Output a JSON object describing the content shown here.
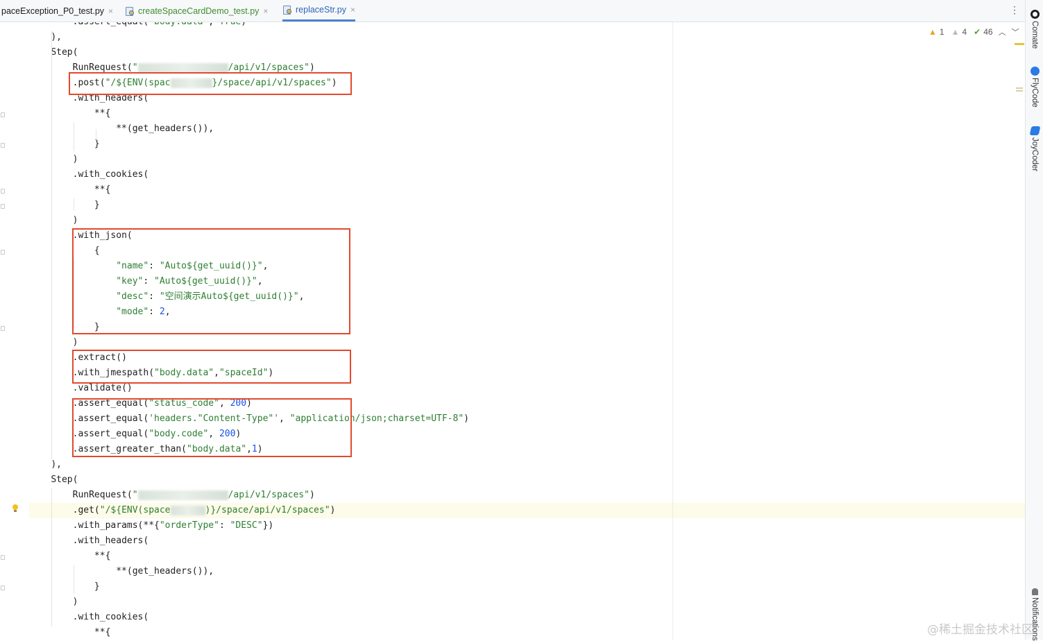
{
  "tabs": [
    {
      "label": "paceException_P0_test.py"
    },
    {
      "label": "createSpaceCardDemo_test.py"
    },
    {
      "label": "replaceStr.py"
    }
  ],
  "tab_close_glyph": "×",
  "tab_menu_glyph": "⋮",
  "inspections": {
    "warnings": "1",
    "weak_warnings": "4",
    "typos": "46"
  },
  "tool_windows": [
    {
      "label": "Comate",
      "color": "#1f1f1f"
    },
    {
      "label": "FlyCode",
      "color": "#2a7be4"
    },
    {
      "label": "JoyCoder",
      "color": "#2a7be4"
    },
    {
      "label": "Notifications",
      "color": "#555555"
    }
  ],
  "code_lines": [
    {
      "i": 4,
      "t": [
        [
          "p",
          ".assert_equal("
        ],
        [
          "s",
          "\"body.data\""
        ],
        [
          "p",
          ", "
        ],
        [
          "s",
          "True"
        ],
        [
          "p",
          ")"
        ]
      ]
    },
    {
      "i": 2,
      "t": [
        [
          "p",
          "),"
        ]
      ]
    },
    {
      "i": 2,
      "t": [
        [
          "p",
          "Step("
        ]
      ]
    },
    {
      "i": 4,
      "t": [
        [
          "p",
          "RunRequest("
        ],
        [
          "s",
          "\""
        ],
        [
          "b",
          "130"
        ],
        [
          "s",
          "/api/v1/spaces\""
        ],
        [
          "p",
          ")"
        ]
      ]
    },
    {
      "i": 4,
      "t": [
        [
          "p",
          ".post("
        ],
        [
          "s",
          "\"/${ENV(spac"
        ],
        [
          "b",
          "60"
        ],
        [
          "s",
          "}/space/api/v1/spaces\""
        ],
        [
          "p",
          ")"
        ]
      ]
    },
    {
      "i": 4,
      "t": [
        [
          "p",
          ".with_headers("
        ]
      ]
    },
    {
      "i": 6,
      "t": [
        [
          "p",
          "**{"
        ]
      ]
    },
    {
      "i": 8,
      "t": [
        [
          "p",
          "**(get_headers()),"
        ]
      ]
    },
    {
      "i": 6,
      "t": [
        [
          "p",
          "}"
        ]
      ]
    },
    {
      "i": 4,
      "t": [
        [
          "p",
          ")"
        ]
      ]
    },
    {
      "i": 4,
      "t": [
        [
          "p",
          ".with_cookies("
        ]
      ]
    },
    {
      "i": 6,
      "t": [
        [
          "p",
          "**{"
        ]
      ]
    },
    {
      "i": 6,
      "t": [
        [
          "p",
          "}"
        ]
      ]
    },
    {
      "i": 4,
      "t": [
        [
          "p",
          ")"
        ]
      ]
    },
    {
      "i": 4,
      "t": [
        [
          "p",
          ".with_json("
        ]
      ]
    },
    {
      "i": 6,
      "t": [
        [
          "p",
          "{"
        ]
      ]
    },
    {
      "i": 8,
      "t": [
        [
          "s",
          "\"name\""
        ],
        [
          "p",
          ": "
        ],
        [
          "s",
          "\"Auto${get_uuid()}\""
        ],
        [
          "p",
          ","
        ]
      ]
    },
    {
      "i": 8,
      "t": [
        [
          "s",
          "\"key\""
        ],
        [
          "p",
          ": "
        ],
        [
          "s",
          "\"Auto${get_uuid()}\""
        ],
        [
          "p",
          ","
        ]
      ]
    },
    {
      "i": 8,
      "t": [
        [
          "s",
          "\"desc\""
        ],
        [
          "p",
          ": "
        ],
        [
          "s",
          "\"空间演示Auto${get_uuid()}\""
        ],
        [
          "p",
          ","
        ]
      ]
    },
    {
      "i": 8,
      "t": [
        [
          "s",
          "\"mode\""
        ],
        [
          "p",
          ": "
        ],
        [
          "n",
          "2"
        ],
        [
          "p",
          ","
        ]
      ]
    },
    {
      "i": 6,
      "t": [
        [
          "p",
          "}"
        ]
      ]
    },
    {
      "i": 4,
      "t": [
        [
          "p",
          ")"
        ]
      ]
    },
    {
      "i": 4,
      "t": [
        [
          "p",
          ".extract()"
        ]
      ]
    },
    {
      "i": 4,
      "t": [
        [
          "p",
          ".with_jmespath("
        ],
        [
          "s",
          "\"body.data\""
        ],
        [
          "p",
          ","
        ],
        [
          "s",
          "\"spaceId\""
        ],
        [
          "p",
          ")"
        ]
      ]
    },
    {
      "i": 4,
      "t": [
        [
          "p",
          ".validate()"
        ]
      ]
    },
    {
      "i": 4,
      "t": [
        [
          "p",
          ".assert_equal("
        ],
        [
          "s",
          "\"status_code\""
        ],
        [
          "p",
          ", "
        ],
        [
          "n",
          "200"
        ],
        [
          "p",
          ")"
        ]
      ]
    },
    {
      "i": 4,
      "t": [
        [
          "p",
          ".assert_equal("
        ],
        [
          "s",
          "'headers.\"Content-Type\"'"
        ],
        [
          "p",
          ", "
        ],
        [
          "s",
          "\"application/json;charset=UTF-8\""
        ],
        [
          "p",
          ")"
        ]
      ]
    },
    {
      "i": 4,
      "t": [
        [
          "p",
          ".assert_equal("
        ],
        [
          "s",
          "\"body.code\""
        ],
        [
          "p",
          ", "
        ],
        [
          "n",
          "200"
        ],
        [
          "p",
          ")"
        ]
      ]
    },
    {
      "i": 4,
      "t": [
        [
          "p",
          ".assert_greater_than("
        ],
        [
          "s",
          "\"body.data\""
        ],
        [
          "p",
          ","
        ],
        [
          "n",
          "1"
        ],
        [
          "p",
          ")"
        ]
      ]
    },
    {
      "i": 2,
      "t": [
        [
          "p",
          "),"
        ]
      ]
    },
    {
      "i": 2,
      "t": [
        [
          "p",
          "Step("
        ]
      ]
    },
    {
      "i": 4,
      "t": [
        [
          "p",
          "RunRequest("
        ],
        [
          "s",
          "\""
        ],
        [
          "b",
          "130"
        ],
        [
          "s",
          "/api/v1/spaces\""
        ],
        [
          "p",
          ")"
        ]
      ]
    },
    {
      "i": 4,
      "hl": true,
      "t": [
        [
          "p",
          ".get("
        ],
        [
          "s",
          "\"/${ENV(space"
        ],
        [
          "b",
          "50"
        ],
        [
          "s",
          ")}/space/api/v1/spaces\""
        ],
        [
          "p",
          ")"
        ]
      ]
    },
    {
      "i": 4,
      "t": [
        [
          "p",
          ".with_params(**{"
        ],
        [
          "s",
          "\"orderType\""
        ],
        [
          "p",
          ": "
        ],
        [
          "s",
          "\"DESC\""
        ],
        [
          "p",
          "})"
        ]
      ]
    },
    {
      "i": 4,
      "t": [
        [
          "p",
          ".with_headers("
        ]
      ]
    },
    {
      "i": 6,
      "t": [
        [
          "p",
          "**{"
        ]
      ]
    },
    {
      "i": 8,
      "t": [
        [
          "p",
          "**(get_headers()),"
        ]
      ]
    },
    {
      "i": 6,
      "t": [
        [
          "p",
          "}"
        ]
      ]
    },
    {
      "i": 4,
      "t": [
        [
          "p",
          ")"
        ]
      ]
    },
    {
      "i": 4,
      "t": [
        [
          "p",
          ".with_cookies("
        ]
      ]
    },
    {
      "i": 6,
      "t": [
        [
          "p",
          "**{"
        ]
      ]
    }
  ],
  "watermark": "@稀土掘金技术社区"
}
